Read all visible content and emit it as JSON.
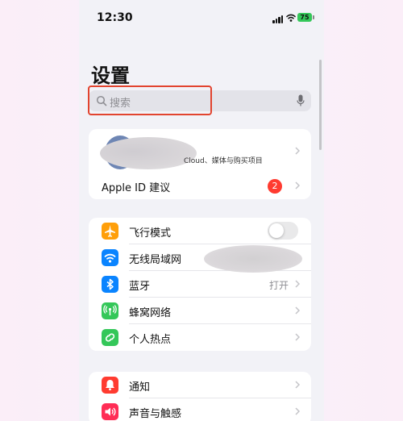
{
  "status_bar": {
    "time": "12:30",
    "battery": "75"
  },
  "page_title": "设置",
  "search": {
    "placeholder": "搜索"
  },
  "profile": {
    "subtitle": "Cloud、媒体与购买项目",
    "apple_id_suggestion": "Apple ID 建议",
    "badge_count": "2"
  },
  "connectivity": {
    "airplane": "飞行模式",
    "wifi": "无线局域网",
    "bluetooth": "蓝牙",
    "bluetooth_value": "打开",
    "cellular": "蜂窝网络",
    "hotspot": "个人热点",
    "airplane_on": false
  },
  "notifications": {
    "notify": "通知",
    "sounds": "声音与触感"
  },
  "colors": {
    "airplane": "#ff9f0a",
    "wifi": "#0a84ff",
    "bluetooth": "#0a84ff",
    "cellular": "#34c759",
    "hotspot": "#34c759",
    "notify": "#ff3b30",
    "sounds": "#ff2d55",
    "highlight": "#e2442f"
  },
  "icons": {
    "airplane": "airplane-icon",
    "wifi": "wifi-icon",
    "bluetooth": "bluetooth-icon",
    "cellular": "cellular-icon",
    "hotspot": "hotspot-icon",
    "notify": "bell-icon",
    "sounds": "speaker-icon"
  }
}
